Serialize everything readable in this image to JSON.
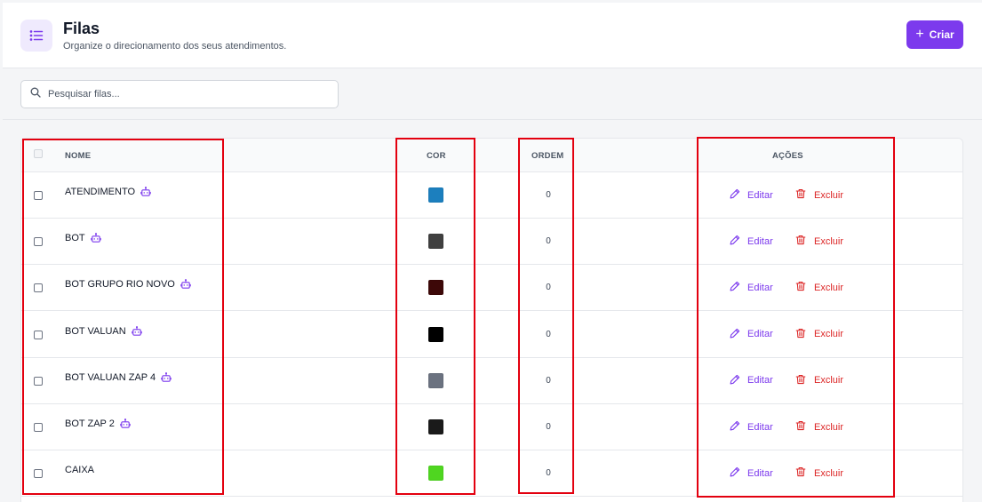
{
  "header": {
    "title": "Filas",
    "subtitle": "Organize o direcionamento dos seus atendimentos.",
    "create_label": "Criar",
    "create_plus": "+"
  },
  "search": {
    "placeholder": "Pesquisar filas..."
  },
  "table": {
    "columns": {
      "name": "NOME",
      "color": "COR",
      "order": "ORDEM",
      "actions": "AÇÕES"
    },
    "edit_label": "Editar",
    "delete_label": "Excluir",
    "rows": [
      {
        "name": "ATENDIMENTO",
        "color": "#1c7fbe",
        "order": "0",
        "bot": true
      },
      {
        "name": "BOT",
        "color": "#404040",
        "order": "0",
        "bot": true
      },
      {
        "name": "BOT GRUPO RIO NOVO",
        "color": "#3d0808",
        "order": "0",
        "bot": true
      },
      {
        "name": "BOT VALUAN",
        "color": "#000000",
        "order": "0",
        "bot": true
      },
      {
        "name": "BOT VALUAN ZAP 4",
        "color": "#6b7280",
        "order": "0",
        "bot": true
      },
      {
        "name": "BOT ZAP 2",
        "color": "#1a1a1a",
        "order": "0",
        "bot": true
      },
      {
        "name": "CAIXA",
        "color": "#4fd620",
        "order": "0",
        "bot": false
      }
    ]
  },
  "colors": {
    "accent": "#7c3aed",
    "danger": "#dc2626",
    "highlight": "#e3000f"
  },
  "icons": {
    "header": "list-icon",
    "search": "search-icon",
    "bot": "robot-icon",
    "edit": "pencil-icon",
    "delete": "trash-icon"
  }
}
